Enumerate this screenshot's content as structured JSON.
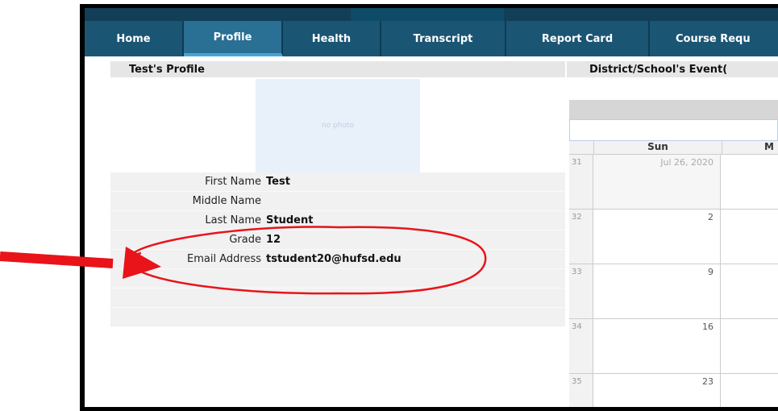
{
  "nav": {
    "tabs": [
      {
        "label": "Home"
      },
      {
        "label": "Profile"
      },
      {
        "label": "Health"
      },
      {
        "label": "Transcript"
      },
      {
        "label": "Report Card"
      },
      {
        "label": "Course Requ"
      }
    ]
  },
  "profile": {
    "title": "Test's Profile",
    "photo_placeholder": "no photo",
    "fields": [
      {
        "label": "First Name",
        "value": "Test"
      },
      {
        "label": "Middle Name",
        "value": ""
      },
      {
        "label": "Last Name",
        "value": "Student"
      },
      {
        "label": "Grade",
        "value": "12"
      },
      {
        "label": "Email Address",
        "value": "tstudent20@hufsd.edu"
      }
    ]
  },
  "events": {
    "title": "District/School's Event(",
    "calendar": {
      "headers": [
        "Sun",
        "M"
      ],
      "weeks": [
        {
          "week": "31",
          "day": "Jul 26, 2020"
        },
        {
          "week": "32",
          "day": "2"
        },
        {
          "week": "33",
          "day": "9"
        },
        {
          "week": "34",
          "day": "16"
        },
        {
          "week": "35",
          "day": "23"
        }
      ]
    }
  },
  "colors": {
    "nav_bg": "#1b5574",
    "nav_active": "#2a6f94",
    "annotation": "#e8141a"
  }
}
